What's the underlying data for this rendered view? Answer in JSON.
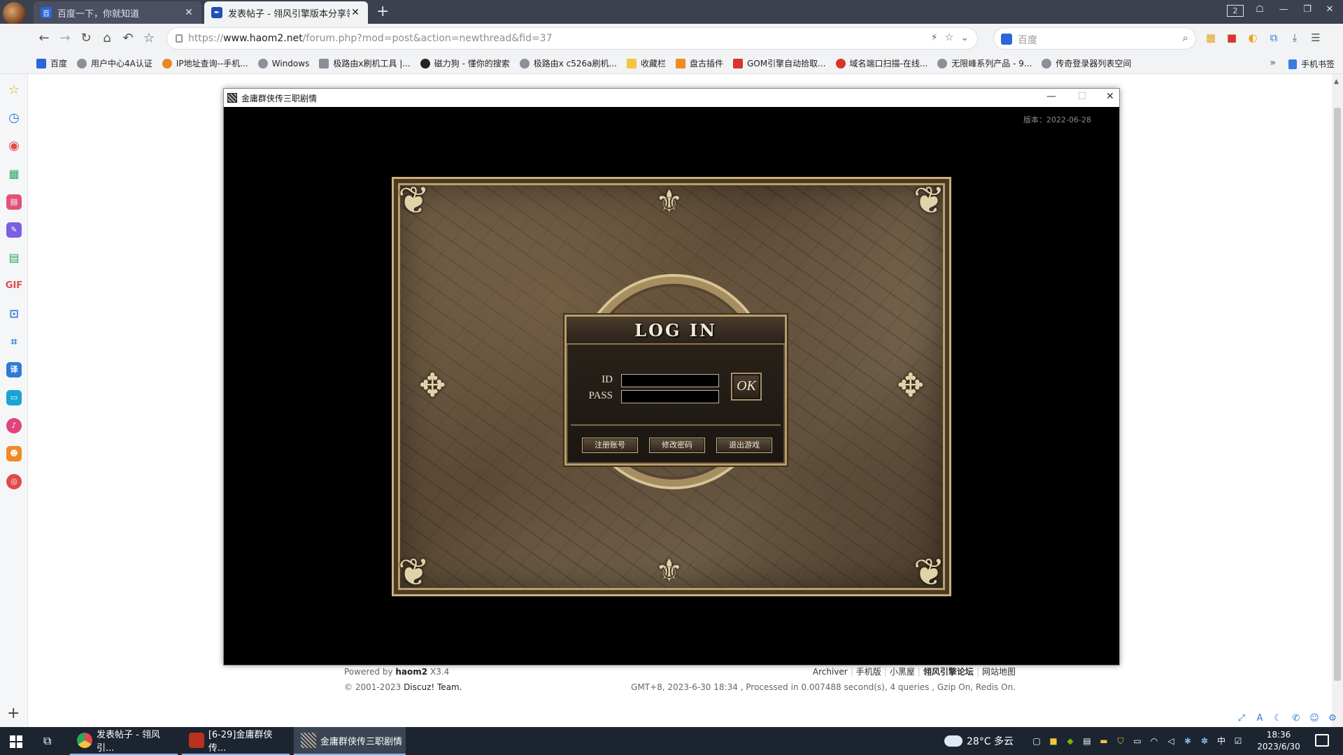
{
  "browser": {
    "tabs": [
      {
        "title": "百度一下，你就知道",
        "active": false
      },
      {
        "title": "发表帖子 - 翎风引擎版本分享翎",
        "active": true
      }
    ],
    "tab_count": "2",
    "url_prefix": "https://",
    "url_domain": "www.haom2.net",
    "url_path": "/forum.php?mod=post&action=newthread&fid=37",
    "search_placeholder": "百度",
    "bookmarks": [
      "百度",
      "用户中心4A认证",
      "IP地址查询--手机...",
      "Windows",
      "极路由x刷机工具 |...",
      "磁力狗 - 懂你的搜索",
      "极路由x c526a刷机...",
      "收藏栏",
      "盘古插件",
      "GOM引擎自动拾取...",
      "域名端口扫描-在线...",
      "无限峰系列产品 - 9...",
      "传奇登录器列表空间"
    ],
    "bookmark_mobile": "手机书签"
  },
  "page": {
    "footer_powered": "Powered by",
    "footer_brand": "haom2",
    "footer_version": "X3.4",
    "footer_copyright": "© 2001-2023",
    "footer_team": "Discuz! Team.",
    "footer_links": [
      "Archiver",
      "手机版",
      "小黑屋",
      "翎风引擎论坛",
      "网站地图"
    ],
    "footer_stats": "GMT+8, 2023-6-30 18:34 , Processed in 0.007488 second(s), 4 queries , Gzip On, Redis On."
  },
  "game_window": {
    "title": "金庸群侠传三职剧情",
    "version": "版本：2022-06-28",
    "login": {
      "heading": "LOG IN",
      "id_label": "ID",
      "pass_label": "PASS",
      "ok_label": "OK",
      "register_label": "注册账号",
      "change_password_label": "修改密码",
      "exit_label": "退出游戏"
    }
  },
  "taskbar": {
    "tasks": [
      {
        "title": "发表帖子 - 翎风引...",
        "active": false
      },
      {
        "title": "[6-29]金庸群侠传...",
        "active": false
      },
      {
        "title": "金庸群侠传三职剧情",
        "active": true
      }
    ],
    "weather": "28°C 多云",
    "ime": "中",
    "time": "18:36",
    "date": "2023/6/30"
  },
  "colors": {
    "tabbar_bg": "#3c4150",
    "taskbar_bg": "#1c2430",
    "frame_gold": "#c9b07a",
    "login_box_bg": "#1b1612"
  }
}
